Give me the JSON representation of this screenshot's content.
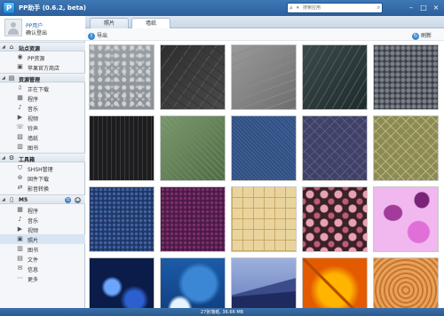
{
  "app": {
    "title": "PP助手 (0.6.2, beta)",
    "logo_letter": "P"
  },
  "search": {
    "placeholder": "搜索应用"
  },
  "window_controls": [
    "minimize",
    "maximize",
    "close"
  ],
  "user": {
    "name": "PP用户",
    "status": "确认登出"
  },
  "sidebar": {
    "sections": [
      {
        "title": "站点资源",
        "icon": "home-icon",
        "items": [
          {
            "label": "PP资源",
            "icon": "pp-resource-icon"
          },
          {
            "label": "苹果官方商店",
            "icon": "apple-store-icon"
          }
        ]
      },
      {
        "title": "资源管理",
        "icon": "resource-manager-icon",
        "items": [
          {
            "label": "正在下载",
            "icon": "download-icon"
          },
          {
            "label": "程序",
            "icon": "app-icon"
          },
          {
            "label": "音乐",
            "icon": "music-icon"
          },
          {
            "label": "视频",
            "icon": "video-icon"
          },
          {
            "label": "铃声",
            "icon": "ringtone-icon"
          },
          {
            "label": "墙纸",
            "icon": "wallpaper-icon"
          },
          {
            "label": "图书",
            "icon": "book-icon"
          }
        ]
      },
      {
        "title": "工具箱",
        "icon": "toolbox-icon",
        "items": [
          {
            "label": "SHSH管理",
            "icon": "shsh-icon"
          },
          {
            "label": "固件下载",
            "icon": "firmware-icon"
          },
          {
            "label": "影音转换",
            "icon": "convert-icon"
          }
        ]
      },
      {
        "title": "M5",
        "icon": "device-icon",
        "items": [
          {
            "label": "程序",
            "icon": "app-icon"
          },
          {
            "label": "音乐",
            "icon": "music-icon"
          },
          {
            "label": "视频",
            "icon": "video-icon"
          },
          {
            "label": "照片",
            "icon": "photo-icon",
            "selected": true
          },
          {
            "label": "图书",
            "icon": "book-icon"
          },
          {
            "label": "文件",
            "icon": "file-icon"
          },
          {
            "label": "信息",
            "icon": "message-icon"
          },
          {
            "label": "更多",
            "icon": "more-icon"
          }
        ]
      }
    ]
  },
  "tabs": [
    {
      "label": "照片",
      "active": false
    },
    {
      "label": "墙纸",
      "active": true
    }
  ],
  "toolbar": {
    "export_label": "导出",
    "refresh_label": "刷新"
  },
  "wallpapers": [
    "water-droplets",
    "dark-cracked-rock",
    "grey-slate",
    "dark-teal-stone",
    "cobblestone",
    "dark-pinstripe",
    "green-leather",
    "blue-denim",
    "purple-diamond-pattern",
    "olive-diamond-pattern",
    "blue-dot-pattern",
    "purple-dot-pattern",
    "tan-weave",
    "pink-floral-pattern",
    "pink-camouflage",
    "blue-bokeh",
    "blue-wave",
    "blue-mountains",
    "orange-leaf",
    "wood-rings"
  ],
  "status": {
    "text": "27张墙纸, 36.66 MB"
  },
  "colors": {
    "titlebar": "#2b5f9c",
    "selected": "#d7e5f4",
    "status": "#2a5a90"
  }
}
